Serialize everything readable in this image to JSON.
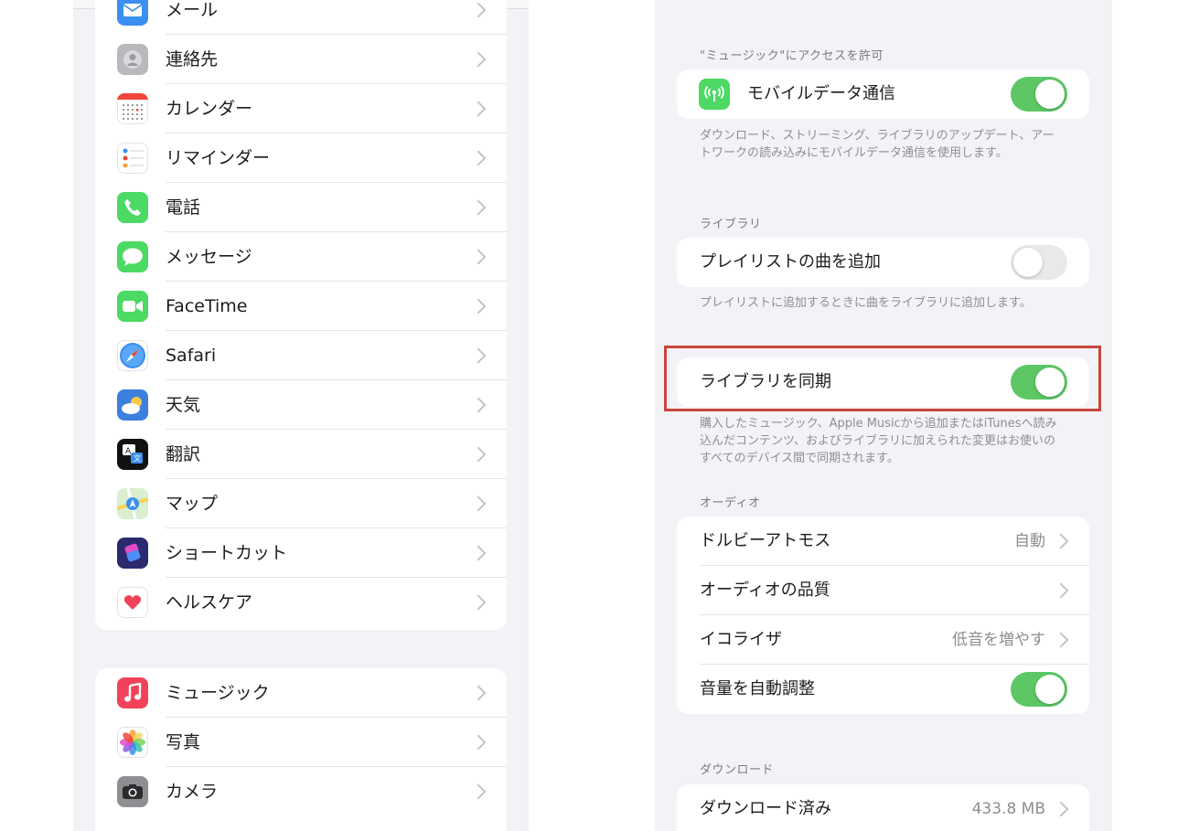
{
  "left": {
    "group1": [
      {
        "label": "メール",
        "icon": "mail-icon",
        "color": "#3b8ff0"
      },
      {
        "label": "連絡先",
        "icon": "contacts-icon",
        "color": "#b8b8bd"
      },
      {
        "label": "カレンダー",
        "icon": "calendar-icon",
        "color": "#ffffff"
      },
      {
        "label": "リマインダー",
        "icon": "reminders-icon",
        "color": "#ffffff"
      },
      {
        "label": "電話",
        "icon": "phone-icon",
        "color": "#4cd964"
      },
      {
        "label": "メッセージ",
        "icon": "messages-icon",
        "color": "#4cd964"
      },
      {
        "label": "FaceTime",
        "icon": "facetime-icon",
        "color": "#4cd964"
      },
      {
        "label": "Safari",
        "icon": "safari-icon",
        "color": "#ffffff"
      },
      {
        "label": "天気",
        "icon": "weather-icon",
        "color": "#3d7fdc"
      },
      {
        "label": "翻訳",
        "icon": "translate-icon",
        "color": "#111111"
      },
      {
        "label": "マップ",
        "icon": "maps-icon",
        "color": "#d9efd0"
      },
      {
        "label": "ショートカット",
        "icon": "shortcuts-icon",
        "color": "#2b2a6e"
      },
      {
        "label": "ヘルスケア",
        "icon": "health-icon",
        "color": "#ffffff"
      }
    ],
    "group2": [
      {
        "label": "ミュージック",
        "icon": "music-icon",
        "color": "#f0435a"
      },
      {
        "label": "写真",
        "icon": "photos-icon",
        "color": "#ffffff"
      },
      {
        "label": "カメラ",
        "icon": "camera-icon",
        "color": "#8e8e93"
      }
    ]
  },
  "right": {
    "access_header": "\"ミュージック\"にアクセスを許可",
    "mobile_data": {
      "label": "モバイルデータ通信",
      "on": true
    },
    "mobile_footer": "ダウンロード、ストリーミング、ライブラリのアップデート、アートワークの読み込みにモバイルデータ通信を使用します。",
    "library_header": "ライブラリ",
    "add_playlist": {
      "label": "プレイリストの曲を追加",
      "on": false
    },
    "add_playlist_footer": "プレイリストに追加するときに曲をライブラリに追加します。",
    "sync_library": {
      "label": "ライブラリを同期",
      "on": true
    },
    "sync_footer": "購入したミュージック、Apple Musicから追加またはiTunesへ読み込んだコンテンツ、およびライブラリに加えられた変更はお使いのすべてのデバイス間で同期されます。",
    "audio_header": "オーディオ",
    "audio": {
      "dolby": {
        "label": "ドルビーアトモス",
        "value": "自動"
      },
      "quality": {
        "label": "オーディオの品質"
      },
      "eq": {
        "label": "イコライザ",
        "value": "低音を増やす"
      },
      "volume": {
        "label": "音量を自動調整",
        "on": true
      }
    },
    "download_header": "ダウンロード",
    "downloaded": {
      "label": "ダウンロード済み",
      "value": "433.8 MB"
    }
  },
  "colors": {
    "toggle_on": "#5dc766",
    "highlight": "#c8453b"
  }
}
